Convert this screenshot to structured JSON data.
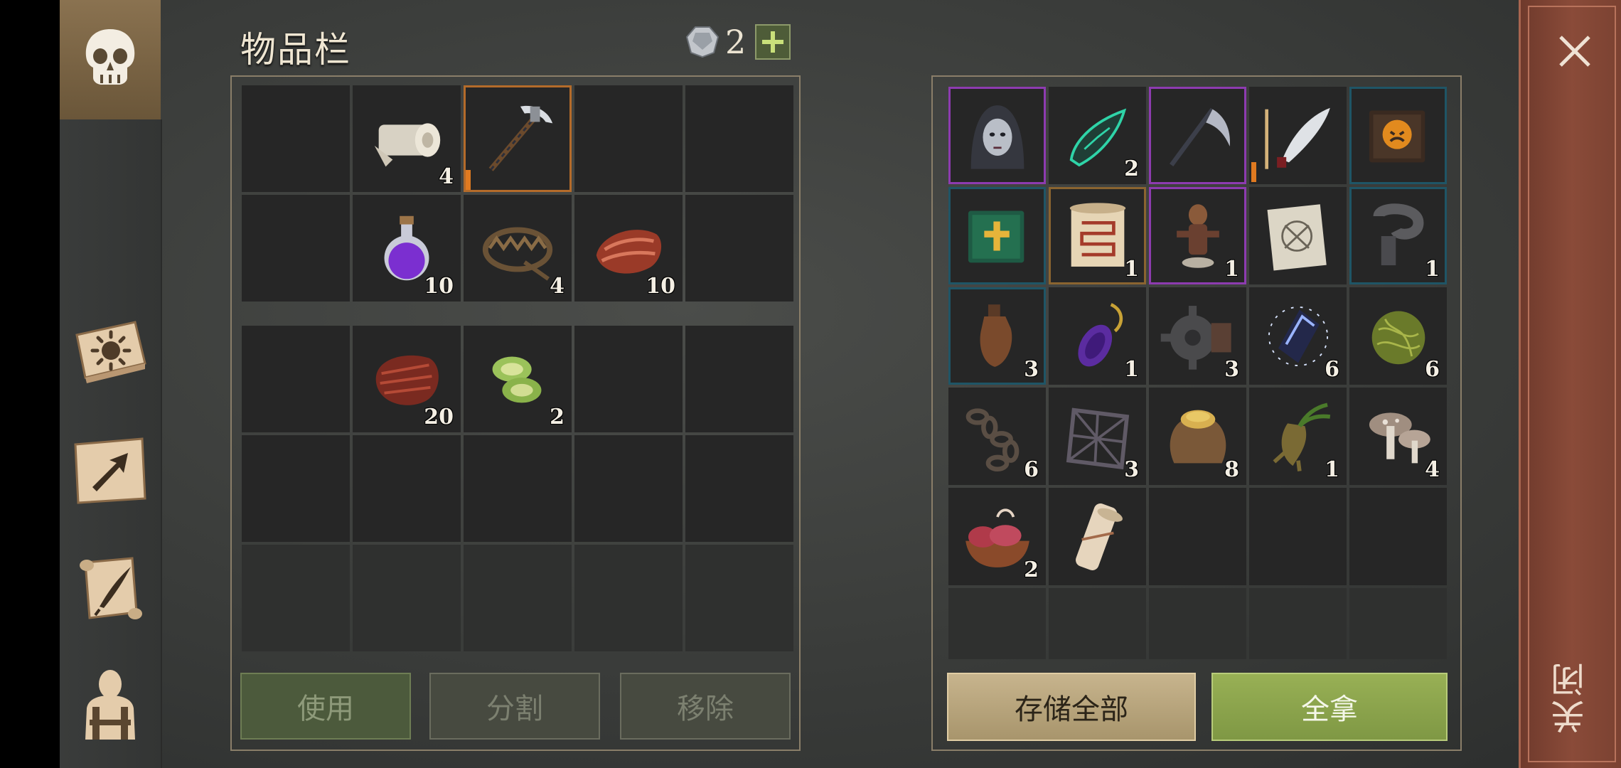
{
  "header": {
    "title": "物品栏",
    "gem_count": "2"
  },
  "nav": {
    "items": [
      {
        "name": "skull-icon"
      },
      {
        "name": "sun-book-icon"
      },
      {
        "name": "map-arrow-icon"
      },
      {
        "name": "scroll-quill-icon"
      },
      {
        "name": "backpack-icon"
      }
    ]
  },
  "close": {
    "label": "关闭"
  },
  "inventory": {
    "slots": [
      [
        {
          "icon": "empty"
        },
        {
          "icon": "bandage-icon",
          "count": "4"
        },
        {
          "icon": "pickaxe-icon",
          "selected": true,
          "durability": 0.3
        },
        {
          "icon": "empty"
        },
        {
          "icon": "empty"
        }
      ],
      [
        {
          "icon": "empty"
        },
        {
          "icon": "purple-potion-icon",
          "count": "10"
        },
        {
          "icon": "bear-trap-icon",
          "count": "4"
        },
        {
          "icon": "raw-meat-icon",
          "count": "10"
        },
        {
          "icon": "empty"
        }
      ]
    ],
    "quick_slots": [
      [
        {
          "icon": "empty"
        },
        {
          "icon": "steak-icon",
          "count": "20"
        },
        {
          "icon": "grilled-vegetables-icon",
          "count": "2"
        },
        {
          "icon": "empty"
        },
        {
          "icon": "empty"
        }
      ],
      [
        {
          "icon": "empty"
        },
        {
          "icon": "empty"
        },
        {
          "icon": "empty"
        },
        {
          "icon": "empty"
        },
        {
          "icon": "empty"
        }
      ],
      [
        {
          "icon": "empty",
          "faded": true
        },
        {
          "icon": "empty",
          "faded": true
        },
        {
          "icon": "empty",
          "faded": true
        },
        {
          "icon": "empty",
          "faded": true
        },
        {
          "icon": "empty",
          "faded": true
        }
      ]
    ],
    "buttons": {
      "use": "使用",
      "split": "分割",
      "remove": "移除"
    }
  },
  "container": {
    "slots": [
      [
        {
          "icon": "hooded-head-icon",
          "rarity": "epic"
        },
        {
          "icon": "green-crystal-shard-icon",
          "count": "2"
        },
        {
          "icon": "scythe-icon",
          "rarity": "epic"
        },
        {
          "icon": "curved-blade-icon",
          "durability": 0.9
        },
        {
          "icon": "evil-tome-icon",
          "rarity": "rare"
        }
      ],
      [
        {
          "icon": "green-holy-book-icon",
          "rarity": "rare"
        },
        {
          "icon": "rune-scroll-icon",
          "count": "1",
          "rarity": "gold"
        },
        {
          "icon": "voodoo-doll-icon",
          "count": "1",
          "rarity": "epic"
        },
        {
          "icon": "blueprint-paper-icon"
        },
        {
          "icon": "iron-clamp-icon",
          "count": "1",
          "rarity": "rare"
        }
      ],
      [
        {
          "icon": "leather-flask-icon",
          "count": "3",
          "rarity": "rare"
        },
        {
          "icon": "amulet-potion-icon",
          "count": "1"
        },
        {
          "icon": "gear-icon",
          "count": "3"
        },
        {
          "icon": "lightning-crystal-icon",
          "count": "6"
        },
        {
          "icon": "herb-ball-icon",
          "count": "6"
        }
      ],
      [
        {
          "icon": "chain-icon",
          "count": "6"
        },
        {
          "icon": "iron-grate-icon",
          "count": "3"
        },
        {
          "icon": "grain-sack-icon",
          "count": "8"
        },
        {
          "icon": "mandrake-root-icon",
          "count": "1"
        },
        {
          "icon": "mushrooms-icon",
          "count": "4"
        }
      ],
      [
        {
          "icon": "organ-bowl-icon",
          "count": "2"
        },
        {
          "icon": "rolled-scroll-icon"
        },
        {
          "icon": "empty"
        },
        {
          "icon": "empty"
        },
        {
          "icon": "empty"
        }
      ],
      [
        {
          "icon": "empty",
          "faded": true
        },
        {
          "icon": "empty",
          "faded": true
        },
        {
          "icon": "empty",
          "faded": true
        },
        {
          "icon": "empty",
          "faded": true
        },
        {
          "icon": "empty",
          "faded": true
        }
      ]
    ],
    "buttons": {
      "store_all": "存储全部",
      "take_all": "全拿"
    }
  },
  "colors": {
    "rare": "#1f5566",
    "epic": "#8d3bb0",
    "selected": "#b46b2a",
    "accent_green": "#8aa44b"
  }
}
